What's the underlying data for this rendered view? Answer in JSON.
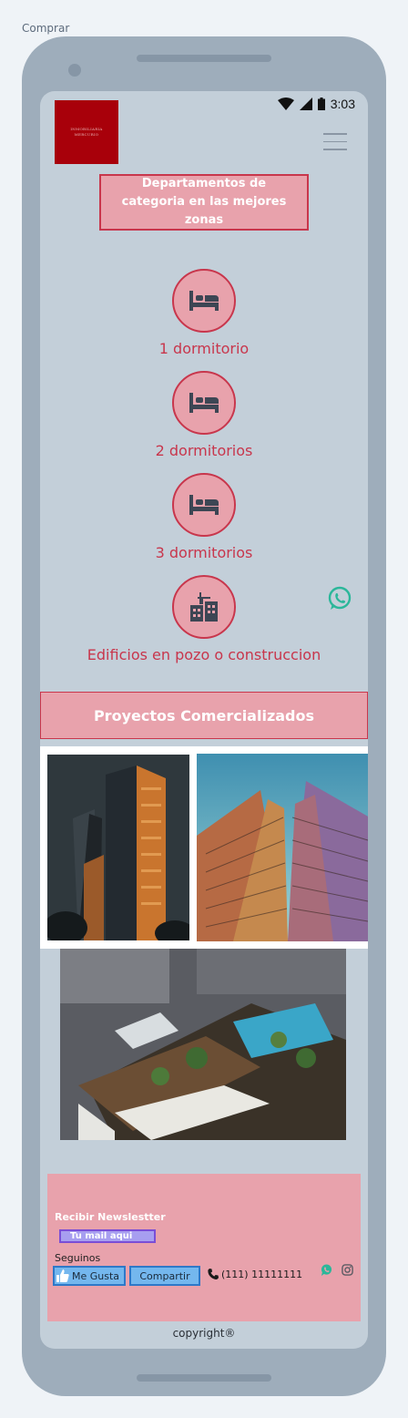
{
  "page_label": "Comprar",
  "status_bar": {
    "time": "3:03"
  },
  "brand": {
    "logo_text": "INMOBILIARIA MERCURIO",
    "primary_color": "#c8364c",
    "accent_color": "#e8a2ac",
    "logo_bg": "#a8000a"
  },
  "hero": {
    "title": "Departamentos de categoria en las mejores zonas"
  },
  "categories": [
    {
      "label": "1 dormitorio",
      "icon": "bed-icon"
    },
    {
      "label": "2 dormitorios",
      "icon": "bed-icon"
    },
    {
      "label": "3 dormitorios",
      "icon": "bed-icon"
    },
    {
      "label": "Edificios en pozo o construccion",
      "icon": "building-icon"
    }
  ],
  "projects": {
    "title": "Proyectos Comercializados"
  },
  "footer": {
    "newsletter_title": "Recibir Newslestter",
    "mail_placeholder": "Tu mail aqui",
    "follow_label": "Seguinos",
    "like_label": "Me Gusta",
    "share_label": "Compartir",
    "phone": "(111) 11111111"
  },
  "copyright": "copyright®"
}
